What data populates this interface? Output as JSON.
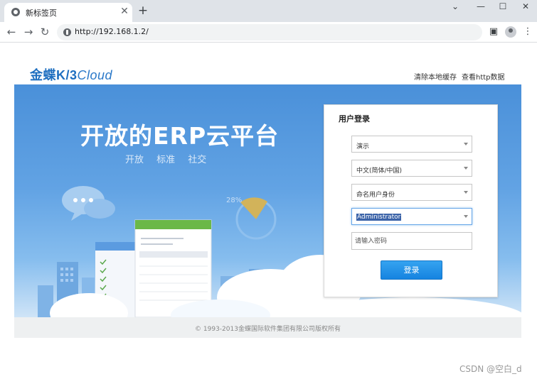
{
  "browser": {
    "tab_title": "新标签页",
    "tab_close": "✕",
    "new_tab": "+",
    "window_controls": {
      "chevron": "⌄",
      "minimize": "—",
      "maximize": "☐",
      "close": "✕"
    },
    "nav": {
      "back": "←",
      "forward": "→",
      "reload": "↻"
    },
    "url": "http://192.168.1.2/",
    "icons": [
      "globe-icon",
      "sidebar-icon",
      "profile-icon",
      "menu-icon"
    ]
  },
  "page": {
    "logo_bold": "金蝶K/3",
    "logo_light": "Cloud",
    "links": {
      "clear_cache": "清除本地缓存",
      "view_http": "查看http数据"
    },
    "hero_title": "开放的ERP云平台",
    "hero_tags": "开放 标准 社交",
    "chart_percent": "28%"
  },
  "login": {
    "title": "用户登录",
    "data_center": "演示",
    "language": "中文(简体/中国)",
    "auth_type": "命名用户身份",
    "username": "Administrator",
    "password_placeholder": "请输入密码",
    "submit": "登录"
  },
  "footer": {
    "copyright": "© 1993-2013金蝶国际软件集团有限公司版权所有"
  },
  "watermark": "CSDN @空白_d",
  "colors": {
    "accent": "#1583e0",
    "banner_top": "#4a90d9",
    "logo": "#1f6fc0"
  }
}
